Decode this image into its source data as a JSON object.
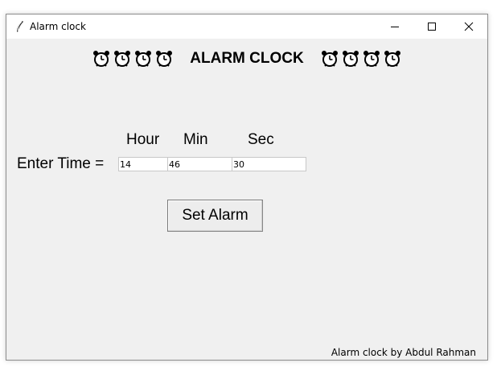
{
  "window": {
    "title": "Alarm clock"
  },
  "header": {
    "title": "ALARM CLOCK",
    "decoration_icon": "alarm-clock-icon"
  },
  "form": {
    "enter_label": "Enter Time =",
    "columns": {
      "hour": "Hour",
      "min": "Min",
      "sec": "Sec"
    },
    "values": {
      "hour": "14",
      "min": "46",
      "sec": "30"
    },
    "set_button_label": "Set Alarm"
  },
  "footer": {
    "credit": "Alarm clock by Abdul Rahman"
  }
}
